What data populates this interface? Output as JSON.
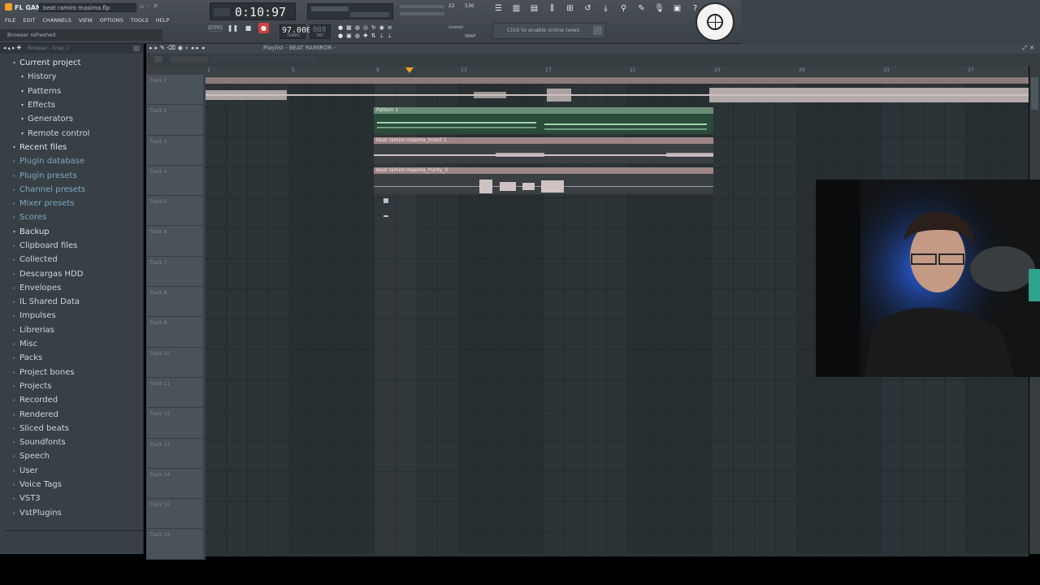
{
  "app": {
    "logo": "FL GANG",
    "project_file": "beat ramiro masima.flp",
    "status_hint": "Browser refreshed"
  },
  "menu": [
    "FILE",
    "EDIT",
    "CHANNELS",
    "VIEW",
    "OPTIONS",
    "TOOLS",
    "HELP"
  ],
  "transport": {
    "time": "0:10:97",
    "tempo": "97.000",
    "tempo_label": "TEMPO",
    "pattern_value": "888",
    "pattern_label": "PAT",
    "cpu": "22",
    "memory": "536",
    "snap_value": "(none)",
    "snap_label": "SNAP"
  },
  "news": {
    "text": "Click to enable online news"
  },
  "browser": {
    "title": "Browser - Snap 2",
    "items": [
      {
        "label": "Current project",
        "style": "cur",
        "level": 0
      },
      {
        "label": "History",
        "style": "normal",
        "level": 1
      },
      {
        "label": "Patterns",
        "style": "normal",
        "level": 1
      },
      {
        "label": "Effects",
        "style": "normal",
        "level": 1
      },
      {
        "label": "Generators",
        "style": "normal",
        "level": 1
      },
      {
        "label": "Remote control",
        "style": "normal",
        "level": 1
      },
      {
        "label": "Recent files",
        "style": "cur",
        "level": 0
      },
      {
        "label": "Plugin database",
        "style": "blue",
        "level": 0
      },
      {
        "label": "Plugin presets",
        "style": "blue",
        "level": 0
      },
      {
        "label": "Channel presets",
        "style": "blue",
        "level": 0
      },
      {
        "label": "Mixer presets",
        "style": "blue",
        "level": 0
      },
      {
        "label": "Scores",
        "style": "blue",
        "level": 0
      },
      {
        "label": "Backup",
        "style": "cur",
        "level": 0
      },
      {
        "label": "Clipboard files",
        "style": "normal",
        "level": 0
      },
      {
        "label": "Collected",
        "style": "normal",
        "level": 0
      },
      {
        "label": "Descargas HDD",
        "style": "normal",
        "level": 0
      },
      {
        "label": "Envelopes",
        "style": "normal",
        "level": 0
      },
      {
        "label": "IL Shared Data",
        "style": "normal",
        "level": 0
      },
      {
        "label": "Impulses",
        "style": "normal",
        "level": 0
      },
      {
        "label": "Librerias",
        "style": "normal",
        "level": 0
      },
      {
        "label": "Misc",
        "style": "normal",
        "level": 0
      },
      {
        "label": "Packs",
        "style": "normal",
        "level": 0
      },
      {
        "label": "Project bones",
        "style": "normal",
        "level": 0
      },
      {
        "label": "Projects",
        "style": "normal",
        "level": 0
      },
      {
        "label": "Recorded",
        "style": "normal",
        "level": 0
      },
      {
        "label": "Rendered",
        "style": "normal",
        "level": 0
      },
      {
        "label": "Sliced beats",
        "style": "normal",
        "level": 0
      },
      {
        "label": "Soundfonts",
        "style": "normal",
        "level": 0
      },
      {
        "label": "Speech",
        "style": "normal",
        "level": 0
      },
      {
        "label": "User",
        "style": "normal",
        "level": 0
      },
      {
        "label": "Voice Tags",
        "style": "normal",
        "level": 0
      },
      {
        "label": "VST3",
        "style": "normal",
        "level": 0
      },
      {
        "label": "VstPlugins",
        "style": "normal",
        "level": 0
      }
    ]
  },
  "playlist": {
    "title": "Playlist - BEAT RAMIROR -",
    "timeline_bars": [
      "1",
      "5",
      "9",
      "13",
      "17",
      "21",
      "25",
      "29",
      "33",
      "37"
    ],
    "tracks": [
      "Track 1",
      "Track 2",
      "Track 3",
      "Track 4",
      "Track 5",
      "Track 6",
      "Track 7",
      "Track 8",
      "Track 9",
      "Track 10",
      "Track 11",
      "Track 12",
      "Track 13",
      "Track 14",
      "Track 15",
      "Track 16"
    ],
    "clips": {
      "pattern": "Pattern 1",
      "audio1": "beat ramiro masima_Insert 1",
      "audio2": "beat ramiro masima_Purity_3"
    }
  }
}
